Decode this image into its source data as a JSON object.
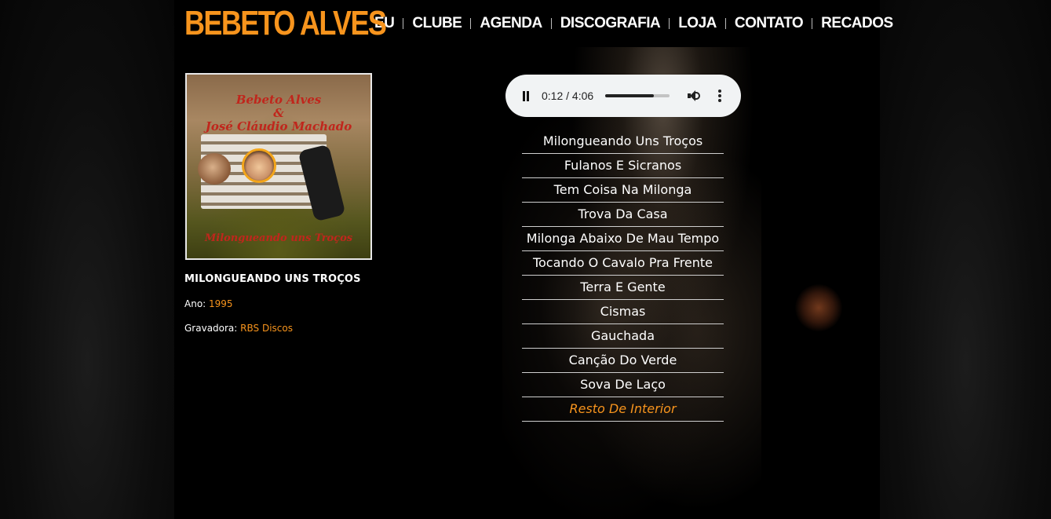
{
  "header": {
    "logo": "BEBETO ALVES",
    "nav": [
      "EU",
      "CLUBE",
      "AGENDA",
      "DISCOGRAFIA",
      "LOJA",
      "CONTATO",
      "RECADOS"
    ]
  },
  "album": {
    "cover_title": "Bebeto Alves & José Cláudio Machado",
    "cover_title_line1": "Bebeto Alves",
    "cover_title_line2": "&",
    "cover_title_line3": "José Cláudio Machado",
    "cover_subtitle": "Milongueando uns Troços",
    "title": "MILONGUEANDO UNS TROÇOS",
    "year_label": "Ano:",
    "year": "1995",
    "label_label": "Gravadora:",
    "label": "RBS Discos"
  },
  "player": {
    "time": "0:12 / 4:06",
    "progress": 0.76,
    "state": "playing",
    "icons": [
      "pause-icon",
      "volume-icon",
      "more-icon"
    ]
  },
  "tracks": [
    "Milongueando Uns Troços",
    "Fulanos E Sicranos",
    "Tem Coisa Na Milonga",
    "Trova Da Casa",
    "Milonga Abaixo De Mau Tempo",
    "Tocando O Cavalo Pra Frente",
    "Terra E Gente",
    "Cismas",
    "Gauchada",
    "Canção Do Verde",
    "Sova De Laço",
    "Resto De Interior"
  ],
  "active_track_index": 11,
  "colors": {
    "accent": "#f7941d",
    "background": "#000000",
    "text": "#ffffff",
    "player_bg": "#f1f3f4"
  }
}
